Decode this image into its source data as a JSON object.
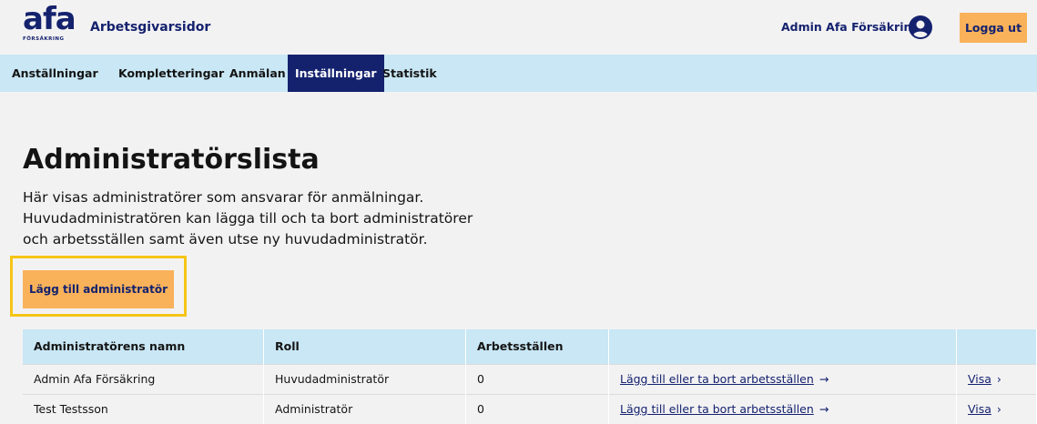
{
  "header": {
    "logo_text": "afa",
    "logo_sub": "FÖRSÄKRING",
    "site_title": "Arbetsgivarsidor",
    "user_name": "Admin Afa Försäkring",
    "logout_label": "Logga ut"
  },
  "nav": {
    "items": [
      "Anställningar",
      "Kompletteringar",
      "Anmälan",
      "Inställningar",
      "Statistik"
    ],
    "active": "Inställningar"
  },
  "main": {
    "title": "Administratörslista",
    "intro_lines": [
      "Här visas administratörer som ansvarar för anmälningar.",
      "Huvudadministratören kan lägga till och ta bort administratörer",
      "och arbetsställen samt även utse ny huvudadministratör."
    ],
    "add_button": "Lägg till administratör"
  },
  "table": {
    "headers": [
      "Administratörens namn",
      "Roll",
      "Arbetsställen",
      "",
      ""
    ],
    "rows": [
      {
        "name": "Admin Afa Försäkring",
        "role": "Huvudadministratör",
        "workplaces": "0",
        "link": "Lägg till eller ta bort arbetsställen",
        "view": "Visa"
      },
      {
        "name": "Test Testsson",
        "role": "Administratör",
        "workplaces": "0",
        "link": "Lägg till eller ta bort arbetsställen",
        "view": "Visa"
      }
    ]
  },
  "colors": {
    "brand_navy": "#14226e",
    "nav_bg": "#c9e7f5",
    "button_orange": "#f9b25a",
    "highlight_yellow": "#f5c518"
  }
}
